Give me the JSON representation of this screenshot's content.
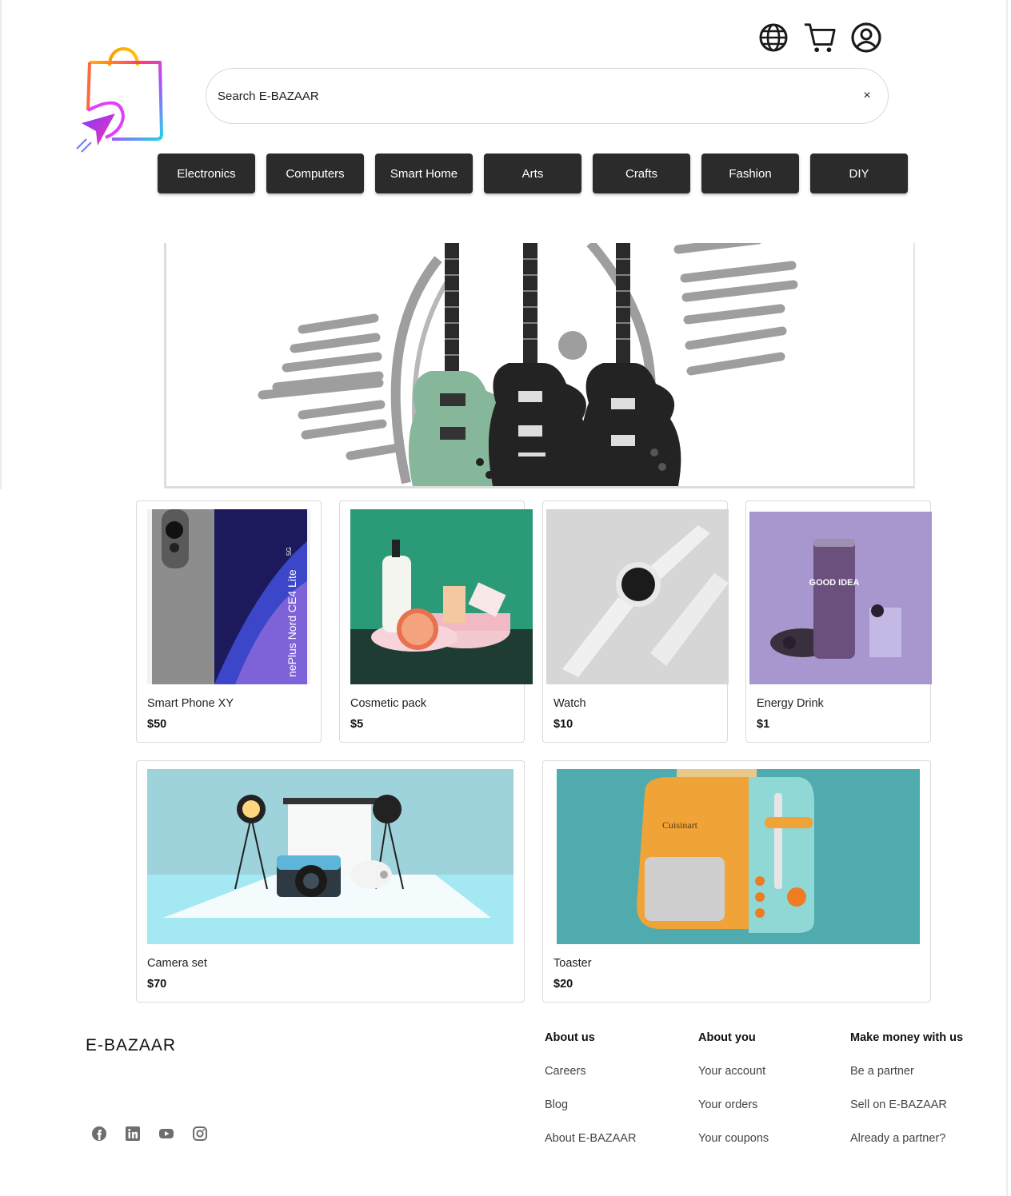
{
  "header": {
    "icons": [
      "globe-icon",
      "cart-icon",
      "user-icon"
    ],
    "search": {
      "placeholder": "Search E-BAZAAR",
      "clear": "×"
    }
  },
  "categories": [
    "Electronics",
    "Computers",
    "Smart Home",
    "Arts",
    "Crafts",
    "Fashion",
    "DIY"
  ],
  "banner": {
    "subject": "guitars"
  },
  "products": [
    {
      "name": "Smart Phone XY",
      "price": "$50",
      "image_text": "nePlus Nord CE4 Lite",
      "image_badge": "5G"
    },
    {
      "name": "Cosmetic pack",
      "price": "$5"
    },
    {
      "name": "Watch",
      "price": "$10"
    },
    {
      "name": "Energy Drink",
      "price": "$1",
      "image_text": "GOOD IDEA"
    },
    {
      "name": "Camera set",
      "price": "$70"
    },
    {
      "name": "Toaster",
      "price": "$20",
      "image_text": "Cuisinart"
    }
  ],
  "footer": {
    "brand": "E-BAZAAR",
    "socials": [
      "facebook-icon",
      "linkedin-icon",
      "youtube-icon",
      "instagram-icon"
    ],
    "columns": [
      {
        "heading": "About us",
        "links": [
          "Careers",
          "Blog",
          "About E-BAZAAR"
        ]
      },
      {
        "heading": "About you",
        "links": [
          "Your account",
          "Your orders",
          "Your coupons"
        ]
      },
      {
        "heading": "Make money with us",
        "links": [
          "Be a partner",
          "Sell on E-BAZAAR",
          "Already a partner?"
        ]
      }
    ]
  },
  "colors": {
    "button_bg": "#2b2b2b",
    "button_text": "#ffffff",
    "border": "#dadada"
  }
}
